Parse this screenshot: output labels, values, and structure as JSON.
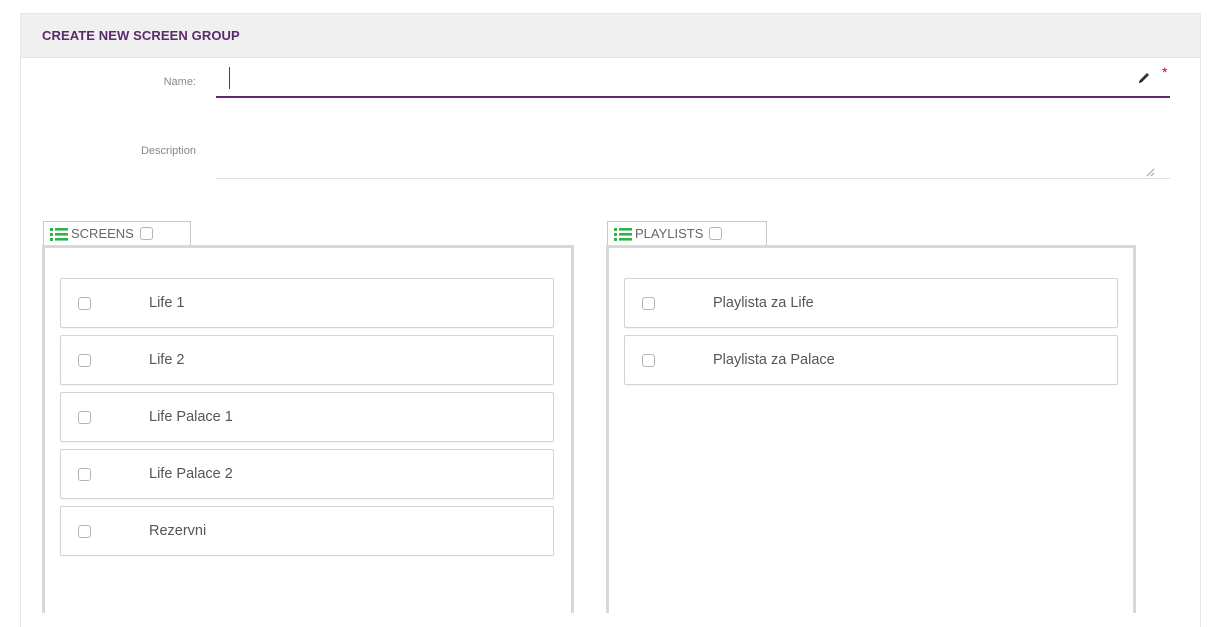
{
  "form": {
    "title": "CREATE NEW SCREEN GROUP",
    "name_label": "Name:",
    "name_value": "",
    "required_marker": "*",
    "description_label": "Description",
    "description_value": ""
  },
  "screens": {
    "header": "SCREENS",
    "items": [
      {
        "label": "Life 1",
        "checked": false
      },
      {
        "label": "Life 2",
        "checked": false
      },
      {
        "label": "Life Palace 1",
        "checked": false
      },
      {
        "label": "Life Palace 2",
        "checked": false
      },
      {
        "label": "Rezervni",
        "checked": false
      }
    ]
  },
  "playlists": {
    "header": "PLAYLISTS",
    "items": [
      {
        "label": "Playlista za Life",
        "checked": false
      },
      {
        "label": "Playlista za Palace",
        "checked": false
      }
    ]
  },
  "colors": {
    "accent": "#5a2a6c",
    "list_icon": "#2db34a",
    "required": "#d0021b"
  },
  "icons": {
    "list_header_icon": "list-icon",
    "edit_icon": "pencil-icon",
    "resize_icon": "resize-handle-icon"
  }
}
